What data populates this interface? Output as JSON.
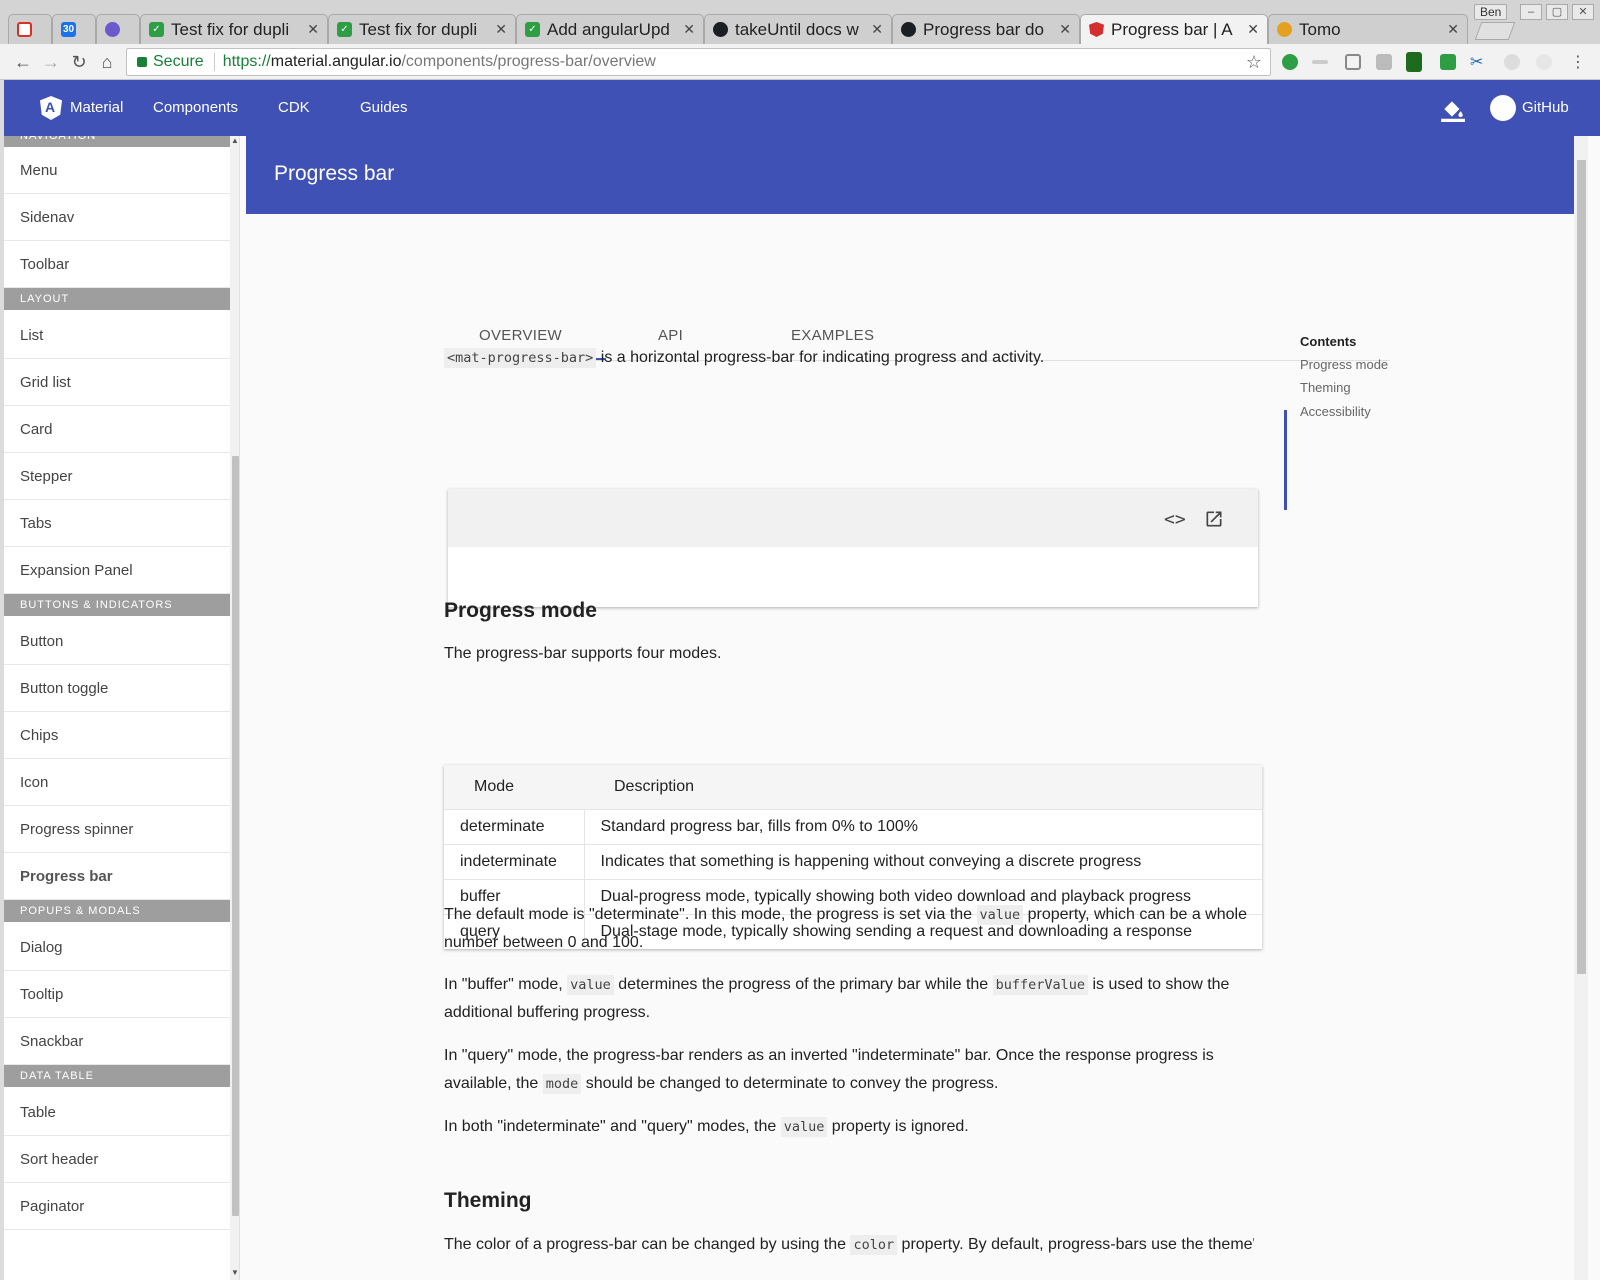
{
  "browser": {
    "tabs": [
      {
        "title": "",
        "favicon": "gmail-icon"
      },
      {
        "title": "",
        "favicon": "calendar-icon",
        "badge": "30"
      },
      {
        "title": "",
        "favicon": "extension-icon"
      },
      {
        "title": "Test fix for dupli",
        "favicon": "check-icon"
      },
      {
        "title": "Test fix for dupli",
        "favicon": "check-icon"
      },
      {
        "title": "Add angularUpd",
        "favicon": "check-icon"
      },
      {
        "title": "takeUntil docs w",
        "favicon": "github-icon"
      },
      {
        "title": "Progress bar do",
        "favicon": "github-icon"
      },
      {
        "title": "Progress bar | A",
        "favicon": "angular-icon",
        "active": true
      },
      {
        "title": "Tomo",
        "favicon": "tomato-icon"
      }
    ],
    "profile_name": "Ben",
    "address": {
      "secure_label": "Secure",
      "scheme": "https://",
      "host": "material.angular.io",
      "path": "/components/progress-bar/overview"
    }
  },
  "appbar": {
    "brand": "Material",
    "links": [
      "Components",
      "CDK",
      "Guides"
    ],
    "github_label": "GitHub"
  },
  "sidebar": {
    "top_section_partial": "NAVIGATION",
    "items": [
      {
        "type": "item",
        "label": "Menu"
      },
      {
        "type": "item",
        "label": "Sidenav"
      },
      {
        "type": "item",
        "label": "Toolbar"
      },
      {
        "type": "section",
        "label": "LAYOUT"
      },
      {
        "type": "item",
        "label": "List"
      },
      {
        "type": "item",
        "label": "Grid list"
      },
      {
        "type": "item",
        "label": "Card"
      },
      {
        "type": "item",
        "label": "Stepper"
      },
      {
        "type": "item",
        "label": "Tabs"
      },
      {
        "type": "item",
        "label": "Expansion Panel"
      },
      {
        "type": "section",
        "label": "BUTTONS & INDICATORS"
      },
      {
        "type": "item",
        "label": "Button"
      },
      {
        "type": "item",
        "label": "Button toggle"
      },
      {
        "type": "item",
        "label": "Chips"
      },
      {
        "type": "item",
        "label": "Icon"
      },
      {
        "type": "item",
        "label": "Progress spinner"
      },
      {
        "type": "item",
        "label": "Progress bar",
        "active": true
      },
      {
        "type": "section",
        "label": "POPUPS & MODALS"
      },
      {
        "type": "item",
        "label": "Dialog"
      },
      {
        "type": "item",
        "label": "Tooltip"
      },
      {
        "type": "item",
        "label": "Snackbar"
      },
      {
        "type": "section",
        "label": "DATA TABLE"
      },
      {
        "type": "item",
        "label": "Table"
      },
      {
        "type": "item",
        "label": "Sort header"
      },
      {
        "type": "item",
        "label": "Paginator"
      }
    ]
  },
  "header": {
    "title": "Progress bar"
  },
  "doc_tabs": [
    "OVERVIEW",
    "API",
    "EXAMPLES"
  ],
  "content": {
    "intro_code": "<mat-progress-bar>",
    "intro_text": " is a horizontal progress-bar for indicating progress and activity.",
    "progress_mode_heading": "Progress mode",
    "modes_intro": "The progress-bar supports four modes.",
    "table_headers": [
      "Mode",
      "Description"
    ],
    "table_rows": [
      [
        "determinate",
        "Standard progress bar, fills from 0% to 100%"
      ],
      [
        "indeterminate",
        "Indicates that something is happening without conveying a discrete progress"
      ],
      [
        "buffer",
        "Dual-progress mode, typically showing both video download and playback progress"
      ],
      [
        "query",
        "Dual-stage mode, typically showing sending a request and downloading a response"
      ]
    ],
    "p1_a": "The default mode is \"determinate\". In this mode, the progress is set via the ",
    "p1_code": "value",
    "p1_b": " property, which can be a whole number between 0 and 100.",
    "p2_a": "In \"buffer\" mode, ",
    "p2_code1": "value",
    "p2_b": " determines the progress of the primary bar while the ",
    "p2_code2": "bufferValue",
    "p2_c": " is used to show the additional buffering progress.",
    "p3_a": "In \"query\" mode, the progress-bar renders as an inverted \"indeterminate\" bar. Once the response progress is available, the ",
    "p3_code": "mode",
    "p3_b": " should be changed to determinate to convey the progress.",
    "p4_a": "In both \"indeterminate\" and \"query\" modes, the ",
    "p4_code": "value",
    "p4_b": " property is ignored.",
    "theming_heading": "Theming",
    "p5_a": "The color of a progress-bar can be changed by using the ",
    "p5_code": "color",
    "p5_b": " property. By default, progress-bars use the theme's"
  },
  "toc": {
    "title": "Contents",
    "items": [
      "Progress mode",
      "Theming",
      "Accessibility"
    ]
  }
}
